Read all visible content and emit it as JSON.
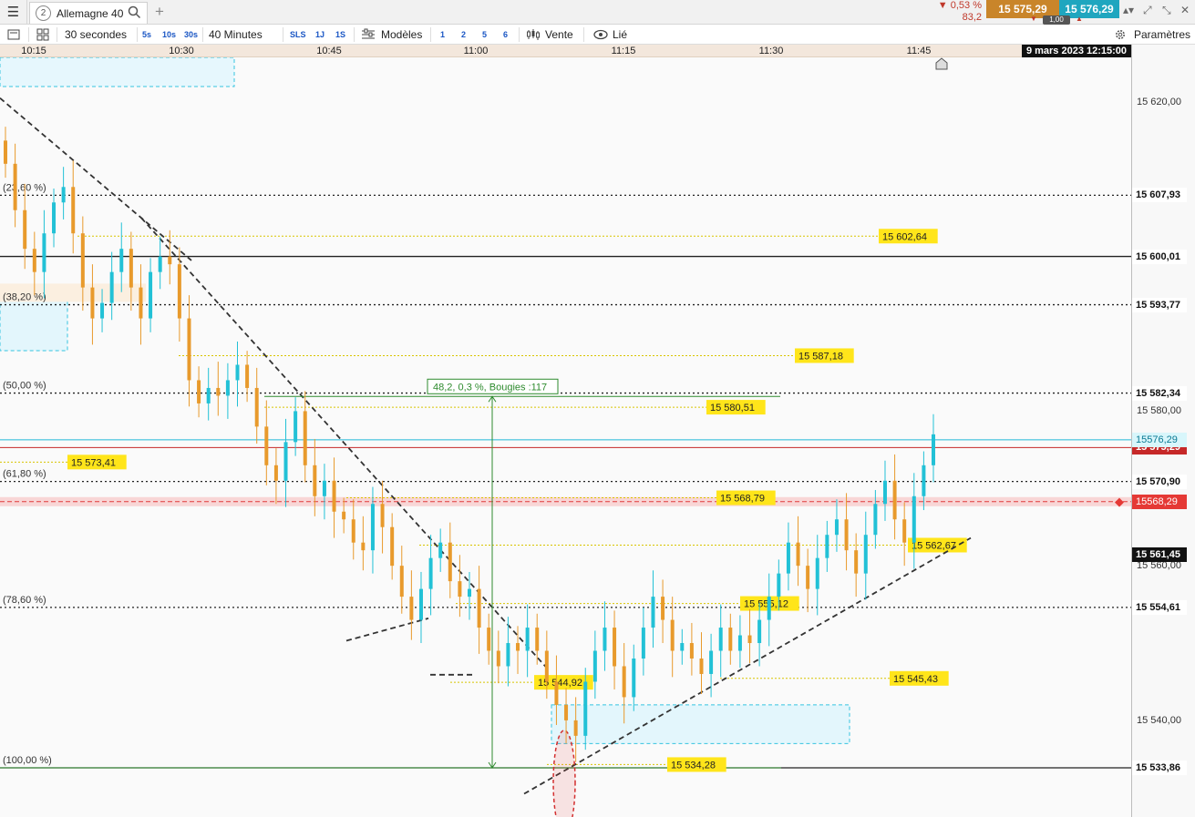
{
  "topbar": {
    "tab_number": "2",
    "tab_title": "Allemagne 40",
    "change_pct": "▼ 0,53 %",
    "change_pts": "83,2",
    "bid": "15 575,29",
    "ask": "15 576,29",
    "quantity": "1,00"
  },
  "toolbar": {
    "interval_primary": "30 secondes",
    "quick_seconds": [
      "5s",
      "10s",
      "30s"
    ],
    "interval_secondary": "40 Minutes",
    "quick_periods": [
      "SLS",
      "1J",
      "1S"
    ],
    "models_label": "Modèles",
    "model_slots": [
      "1",
      "2",
      "5",
      "6"
    ],
    "sell_label": "Vente",
    "linked_label": "Lié",
    "settings_label": "Paramètres"
  },
  "time_axis": {
    "labels": [
      "10:15",
      "10:30",
      "10:45",
      "11:00",
      "11:15",
      "11:30",
      "11:45"
    ],
    "current_date": "9 mars 2023 12:15:00"
  },
  "chart_data": {
    "type": "candlestick",
    "instrument": "Allemagne 40",
    "timeframe": "30 secondes",
    "y_axis_ticks": [
      15620,
      15600,
      15580,
      15560,
      15540
    ],
    "y_axis_tick_labels": [
      "15 620,00",
      "15 600,01",
      "15 580,00",
      "15 560,00",
      "15 540,00"
    ],
    "ylim": [
      15524,
      15637
    ],
    "horizontal_levels": [
      {
        "label": "15 607,93",
        "value": 15607.93,
        "style": "dotted-black"
      },
      {
        "label": "15 600,01",
        "value": 15600.01,
        "style": "solid-black"
      },
      {
        "label": "15 593,77",
        "value": 15593.77,
        "style": "dotted-black"
      },
      {
        "label": "15 582,34",
        "value": 15582.34,
        "style": "dotted-black"
      },
      {
        "label": "15 570,90",
        "value": 15570.9,
        "style": "dotted-black"
      },
      {
        "label": "15 554,61",
        "value": 15554.61,
        "style": "dotted-black"
      },
      {
        "label": "15 533,86",
        "value": 15533.86,
        "style": "solid-black"
      }
    ],
    "fibonacci_labels": [
      {
        "text": "(23,60 %)",
        "value": 15607.93
      },
      {
        "text": "(38,20 %)",
        "value": 15593.77
      },
      {
        "text": "(50,00 %)",
        "value": 15582.34
      },
      {
        "text": "(61,80 %)",
        "value": 15570.9
      },
      {
        "text": "(78,60 %)",
        "value": 15554.61
      },
      {
        "text": "(100,00 %)",
        "value": 15533.86
      }
    ],
    "yellow_levels": [
      {
        "label": "15 602,64",
        "value": 15602.64
      },
      {
        "label": "15 587,18",
        "value": 15587.18
      },
      {
        "label": "15 580,51",
        "value": 15580.51
      },
      {
        "label": "15 573,41",
        "value": 15573.41
      },
      {
        "label": "15 568,79",
        "value": 15568.79
      },
      {
        "label": "15 562,67",
        "value": 15562.67
      },
      {
        "label": "15 555,12",
        "value": 15555.12
      },
      {
        "label": "15 545,43",
        "value": 15545.43
      },
      {
        "label": "15 544,92",
        "value": 15544.92
      },
      {
        "label": "15 534,28",
        "value": 15534.28
      }
    ],
    "current_bid": {
      "label": "15576,29",
      "value": 15576.29
    },
    "current_ask": {
      "label": "15 575,29",
      "value": 15575.29
    },
    "alert_level": {
      "label": "15568,29",
      "value": 15568.29
    },
    "black_marker": {
      "label": "15 561,45",
      "value": 15561.45
    },
    "measure_label": "48,2, 0,3 %, Bougies :117",
    "close_series": [
      15612,
      15606,
      15601,
      15598,
      15603,
      15607,
      15609,
      15603,
      15596,
      15592,
      15594,
      15598,
      15601,
      15596,
      15592,
      15598,
      15600,
      15599,
      15592,
      15584,
      15581,
      15583,
      15582,
      15584,
      15586,
      15583,
      15578,
      15573,
      15571,
      15576,
      15580,
      15573,
      15569,
      15571,
      15567,
      15566,
      15563,
      15562,
      15568,
      15565,
      15560,
      15556,
      15553,
      15557,
      15561,
      15563,
      15558,
      15556,
      15557,
      15552,
      15549,
      15547,
      15550,
      15549,
      15552,
      15549,
      15545,
      15542,
      15540,
      15538,
      15545,
      15549,
      15552,
      15547,
      15543,
      15548,
      15552,
      15556,
      15553,
      15549,
      15550,
      15548,
      15546,
      15549,
      15552,
      15549,
      15551,
      15550,
      15553,
      15556,
      15559,
      15563,
      15560,
      15557,
      15561,
      15564,
      15566,
      15562,
      15559,
      15564,
      15568,
      15571,
      15566,
      15563,
      15569,
      15573,
      15577
    ]
  }
}
